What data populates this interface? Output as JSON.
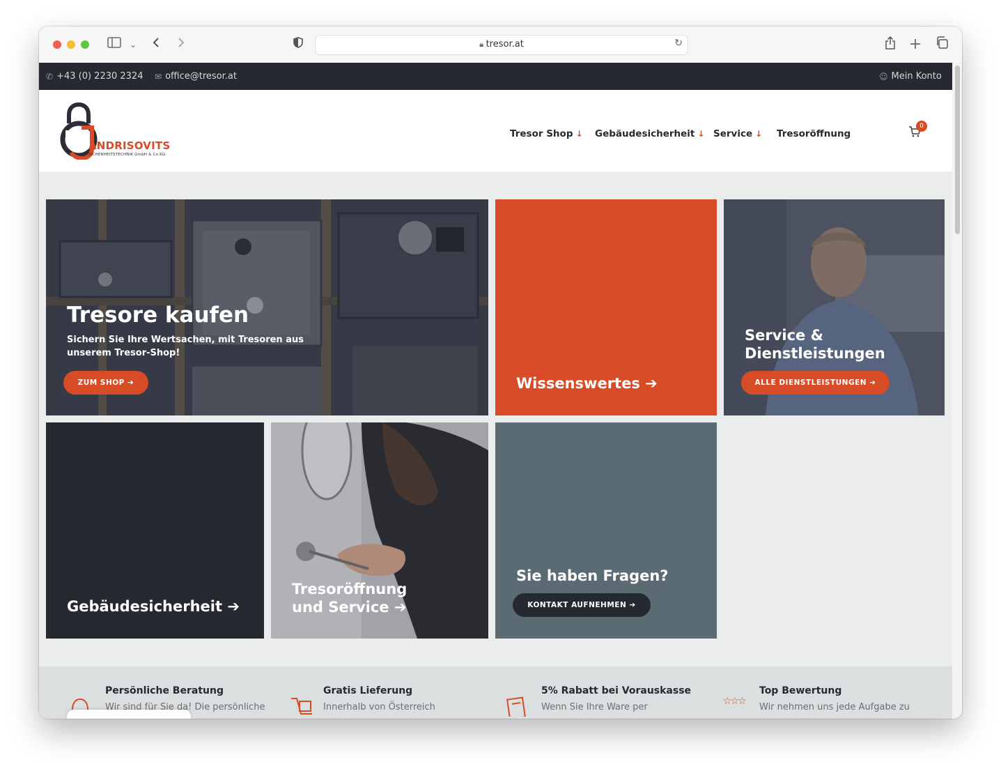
{
  "browser": {
    "url": "tresor.at"
  },
  "topbar": {
    "phone": "+43 (0) 2230 2324",
    "email": "office@tresor.at",
    "account": "Mein Konto"
  },
  "logo": {
    "name": "ANDRISOVITS",
    "initial": "J",
    "subtitle": "SICHERHEITSTECHNIK GmbH & Co KG"
  },
  "nav": {
    "items": [
      {
        "label": "Tresor Shop",
        "dropdown": true
      },
      {
        "label": "Gebäudesicherheit",
        "dropdown": true
      },
      {
        "label": "Service",
        "dropdown": true
      },
      {
        "label": "Tresoröffnung",
        "dropdown": false
      }
    ],
    "cart_count": "0"
  },
  "tiles": {
    "shop": {
      "title": "Tresore kaufen",
      "text": "Sichern Sie Ihre Wertsachen, mit Tresoren aus unserem Tresor-Shop!",
      "button": "ZUM SHOP ➔"
    },
    "wissen": {
      "title": "Wissenswertes ➔"
    },
    "service": {
      "title": "Service & Dienstleistungen",
      "button": "ALLE DIENSTLEISTUNGEN ➔"
    },
    "gebaeude": {
      "title": "Gebäudesicherheit ➔"
    },
    "tresor": {
      "title": "Tresoröffnung und Service ➔"
    },
    "fragen": {
      "title": "Sie haben Fragen?",
      "button": "KONTAKT AUFNEHMEN ➔"
    }
  },
  "features": [
    {
      "title": "Persönliche Beratung",
      "text": "Wir sind für Sie da! Die persönliche"
    },
    {
      "title": "Gratis Lieferung",
      "text": "Innerhalb von Österreich"
    },
    {
      "title": "5% Rabatt bei Vorauskasse",
      "text": "Wenn Sie Ihre Ware per"
    },
    {
      "title": "Top Bewertung",
      "text": "Wir nehmen uns jede Aufgabe zu"
    }
  ],
  "colors": {
    "accent": "#d84b27",
    "dark": "#262930",
    "slate": "#5b6b74",
    "background": "#ebecec"
  }
}
